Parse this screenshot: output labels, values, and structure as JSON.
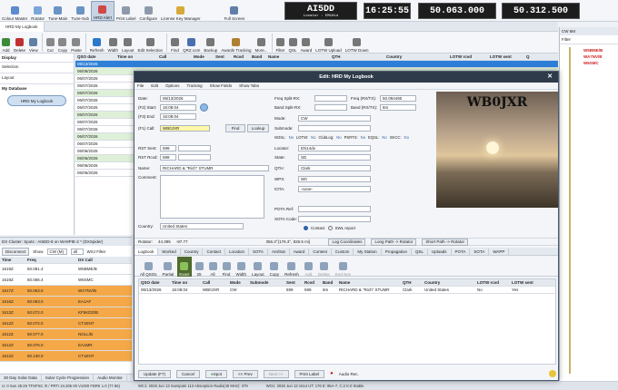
{
  "ribbon": {
    "items": [
      "Colour Master",
      "Rotator",
      "Tune-Main",
      "Tune-Sub",
      "HRD Alert",
      "Print Label",
      "Configure",
      "License Key Manager",
      "Full Screen"
    ],
    "callsign": "AI5DD",
    "locator": "Locator : EM10id",
    "time": "16:25:55",
    "freq_main": "50.063.000",
    "freq_sub": "50.312.500"
  },
  "doc_tab": "HRD My Logbook",
  "toolbar": [
    "Add",
    "Delete",
    "View",
    "Cut",
    "Copy",
    "Paste",
    "Refresh",
    "Width",
    "Layout",
    "Edit Selection",
    "Find",
    "QRZ.com",
    "Backup",
    "Awards Tracking",
    "More...",
    "Filter",
    "QSL",
    "Award",
    "LOTW Upload",
    "LOTW Down"
  ],
  "sidebar": {
    "display": "Display",
    "selection": "Selection",
    "layout": "Layout",
    "my_database": "My Database",
    "button": "HRD My Logbook"
  },
  "logbook": {
    "headers": [
      "QSO date",
      "Time on",
      "Call",
      "Mode",
      "Sent",
      "Rcvd",
      "Band",
      "Name",
      "QTH",
      "Country",
      "LOTW rcvd",
      "LOTW sent",
      "Q"
    ],
    "dates": [
      "06/13/2026",
      "06/08/2026",
      "06/07/2026",
      "06/07/2026",
      "06/07/2026",
      "06/07/2026",
      "06/07/2026",
      "06/07/2026",
      "06/07/2026",
      "06/07/2026",
      "06/07/2026",
      "06/07/2026",
      "06/06/2026",
      "06/06/2026",
      "06/06/2026",
      "06/06/2026"
    ]
  },
  "cluster": {
    "title": "DX Cluster: Spots : AI5DD-8 on WA9PIE-2 * (DXSpider)",
    "disconnect": "Disconnect",
    "show": "Show",
    "mode": "CW (M)",
    "band": "all",
    "filter": "WSJ Filter",
    "headers": [
      "Time",
      "Freq",
      "",
      "",
      "DX Call"
    ],
    "rows": [
      [
        "1619Z",
        "50.081.4",
        "W5BME/B"
      ],
      [
        "1619Z",
        "50.066.4",
        "W6SMC"
      ],
      [
        "1617Z",
        "50.063.0",
        "WA7NV/B"
      ],
      [
        "1616Z",
        "50.063.0",
        "EA1AF"
      ],
      [
        "1613Z",
        "50.072.0",
        "KF5KDD/B"
      ],
      [
        "1612Z",
        "50.072.0",
        "CT1ENT"
      ],
      [
        "1612Z",
        "50.077.0",
        "NOLL/B"
      ],
      [
        "1612Z",
        "50.076.0",
        "EA1MR"
      ],
      [
        "1612Z",
        "50.130.0",
        "CT1ENT"
      ]
    ]
  },
  "status_tabs": [
    "30 Day Solar Data",
    "Solar Cycle Progression",
    "Audio Monitor"
  ],
  "status_bar": "U: 0 Sun 25:26 TFSPSC /0 / PRTI 24.305 00 V1000 FBRK 1.0 (77.85)",
  "status_bar_right": "WO1: 2026 Jun 13 1514 UT: 176 E: 95A-7, C:2 K:0 Stable",
  "status_bar_center": "WC1: 2026 Jun 13 Sunspots 113 Absorption Radio(40 MHz): 379",
  "right_panel": {
    "title": "CW 6M",
    "filter": "Filter",
    "spots": [
      "W5BME/B",
      "WA7NV/B",
      "W6SMC"
    ]
  },
  "dialog": {
    "title": "Edit: HRD My Logbook",
    "menu": [
      "File",
      "Edit",
      "Options",
      "Tracking",
      "Show Fields",
      "Show Tabs"
    ],
    "date_label": "Date:",
    "date": "06/13/2026",
    "f2_start_label": "(F2) Start:",
    "start": "16:08:04",
    "f3_end_label": "(F3) End:",
    "end": "16:08:04",
    "f1_call_label": "(F1) Call:",
    "call": "WB0JXR",
    "find": "Find",
    "lookup": "Lookup",
    "rst_sent_label": "RST Sent:",
    "rst_sent": "599",
    "rst_rcvd_label": "RST Rcvd:",
    "rst_rcvd": "599",
    "name_label": "Name:",
    "name": "RICHARD & \"Rich\" STUMR",
    "comment_label": "Comment:",
    "country_label": "Country:",
    "country": "United States",
    "freq_rx_label": "Freq Split-RX:",
    "freq_tx_label": "Freq (RX/TX):",
    "freq": "50.094490",
    "band_rx_label": "Band Split-RX:",
    "band_tx_label": "Band (RX/TX):",
    "band": "6m",
    "mode_label": "Mode:",
    "mode": "CW",
    "submode_label": "Submode:",
    "w2sl_label": "W2SL:",
    "w2sl": "No",
    "lotw_label": "LOTW:",
    "lotw": "No",
    "club_label": "ClubLog:",
    "club": "No",
    "ps_label": "PSRTS:",
    "ps": "No",
    "eqsl_label": "EQSL:",
    "eqsl": "No",
    "skcc_label": "SKCC:",
    "skcc": "No",
    "locator_label": "Locator:",
    "locator": "EN14dv",
    "state_label": "State:",
    "state": "SD",
    "qth_label": "QTH:",
    "qth": "Clark",
    "wpx_label": "WPX:",
    "wpx": "W0",
    "iota_label": "IOTA:",
    "iota": "-none-",
    "pota_label": "POTA Ref:",
    "sota_label": "SOTA Code:",
    "contact": "Contact",
    "swl": "SWL report",
    "rotator_label": "Rotator:",
    "rotator": "44.395",
    "rot2": "-97.77",
    "sp": "356.3°(176.3°, 826.5 mi)",
    "lc": "Log Coordinates",
    "lp": "Long Path -> Rotator",
    "sp_rot": "Short Path -> Rotator",
    "photo_call": "WB0JXR",
    "tabs": [
      "Logbook",
      "Worked",
      "Country",
      "Contact",
      "Location",
      "SOTA",
      "Ant/Sat",
      "Award",
      "Contest",
      "Custom",
      "My Station",
      "Propagation",
      "QSL",
      "Uploads",
      "POTA",
      "SOTA",
      "WAPP"
    ],
    "sub_toolbar": [
      "All QSOs",
      "Partial",
      "Exact",
      "25",
      "All",
      "Find",
      "Width",
      "Layout",
      "Copy",
      "Refresh",
      "Add",
      "Delete",
      "End Nov"
    ],
    "table_headers": [
      "QSO date",
      "Time on",
      "Call",
      "Mode",
      "Submode",
      "Sent",
      "Rcvd",
      "Band",
      "Name",
      "QTH",
      "Country",
      "LOTW rcvd",
      "LOTW sent"
    ],
    "table_row": [
      "06/13/2026",
      "16:08:04",
      "WB0JXR",
      "CW",
      "",
      "599",
      "599",
      "6m",
      "RICHARD & \"Rich\" STUMR",
      "Clark",
      "United States",
      "No",
      "Yes"
    ],
    "bottom": [
      "Update (F7)",
      "Cancel",
      "Spot",
      "<< Prev",
      "Next >>",
      "Print Label",
      "Audio Rec."
    ]
  }
}
